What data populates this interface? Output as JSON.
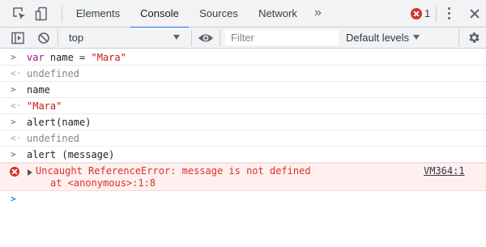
{
  "tabs": [
    {
      "label": "Elements"
    },
    {
      "label": "Console"
    },
    {
      "label": "Sources"
    },
    {
      "label": "Network"
    }
  ],
  "active_tab": "Console",
  "more_tabs_glyph": "»",
  "error_count": "1",
  "toolbar": {
    "context": "top",
    "filter_placeholder": "Filter",
    "levels_label": "Default levels"
  },
  "console": {
    "prompt_glyph": ">",
    "result_glyph": "<·",
    "lines": [
      {
        "kind": "input",
        "keyword": "var",
        "rest": " name = ",
        "string": "\"Mara\""
      },
      {
        "kind": "result",
        "text": "undefined"
      },
      {
        "kind": "input",
        "text": "name"
      },
      {
        "kind": "result",
        "string": "\"Mara\""
      },
      {
        "kind": "input",
        "text": "alert(name)"
      },
      {
        "kind": "result",
        "text": "undefined"
      },
      {
        "kind": "input",
        "text": "alert (message)"
      }
    ],
    "error": {
      "message": "Uncaught ReferenceError: message is not defined",
      "stack": "at <anonymous>:1:8",
      "source": "VM364:1"
    }
  },
  "icons": {
    "inspect": "inspect-element-icon",
    "device": "device-toolbar-icon",
    "sidebar": "show-sidebar-icon",
    "clear": "clear-console-icon",
    "eye": "live-expression-icon",
    "settings": "gear-icon"
  },
  "colors": {
    "accent": "#1a73e8",
    "error": "#d93025",
    "error_bg": "#fff0f0",
    "string": "#c41a16",
    "keyword": "#aa0d91"
  }
}
